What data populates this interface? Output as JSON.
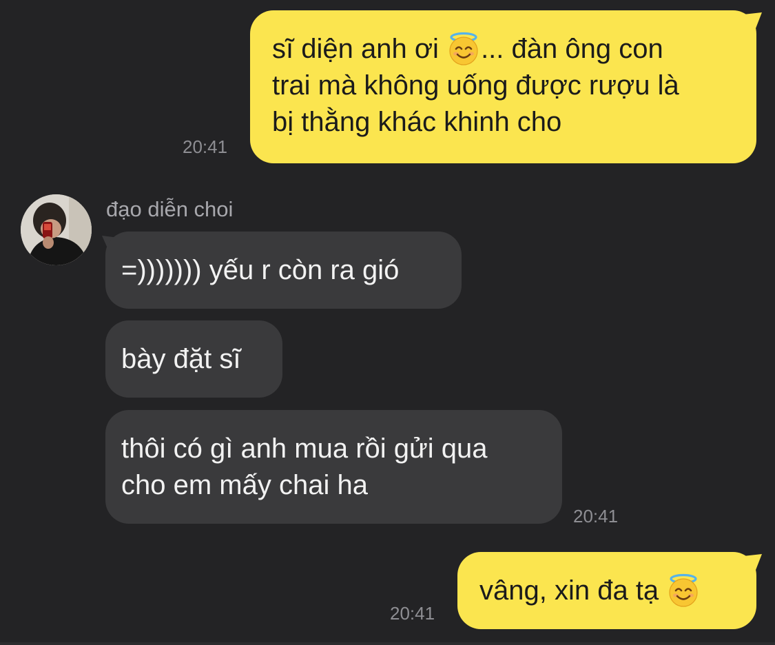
{
  "colors": {
    "background": "#232325",
    "outgoing_bubble": "#fbe54f",
    "incoming_bubble": "#3a3a3c",
    "timestamp": "#8e8e93"
  },
  "conversation": {
    "contact_name": "đạo diễn choi",
    "messages": [
      {
        "direction": "outgoing",
        "lines": [
          "sĩ diện anh ơi",
          "... đàn ông con",
          "trai mà không uống được rượu là",
          "bị thằng khác khinh cho"
        ],
        "emoji": "smiling-face-with-halo-icon",
        "time": "20:41"
      },
      {
        "direction": "incoming",
        "lines": [
          "=))))))) yếu r còn ra gió"
        ]
      },
      {
        "direction": "incoming",
        "lines": [
          "bày đặt sĩ"
        ]
      },
      {
        "direction": "incoming",
        "lines": [
          "thôi có gì anh mua rồi gửi qua",
          "cho em mấy chai ha"
        ],
        "time": "20:41"
      },
      {
        "direction": "outgoing",
        "lines": [
          "vâng, xin đa tạ"
        ],
        "emoji": "smiling-face-with-halo-icon",
        "time": "20:41"
      }
    ]
  }
}
